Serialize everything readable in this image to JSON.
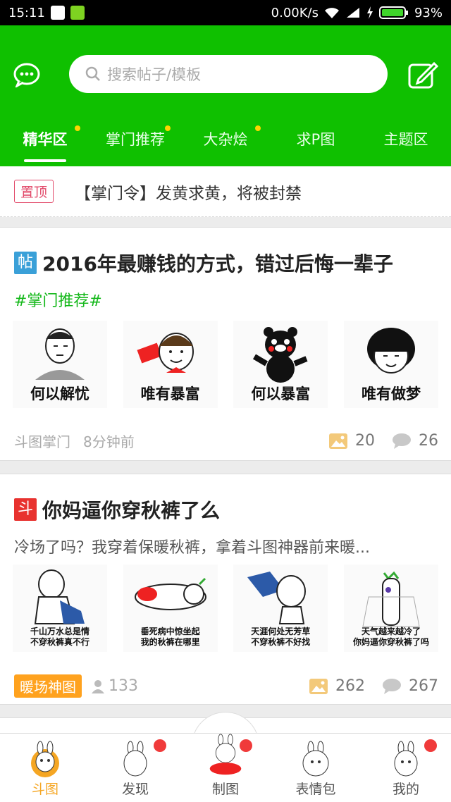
{
  "status_bar": {
    "time": "15:11",
    "network": "0.00K/s",
    "battery": "93%"
  },
  "header": {
    "search_placeholder": "搜索帖子/模板",
    "tabs": [
      {
        "label": "精华区",
        "dot": true,
        "active": true
      },
      {
        "label": "掌门推荐",
        "dot": true
      },
      {
        "label": "大杂烩",
        "dot": true
      },
      {
        "label": "求P图",
        "dot": false
      },
      {
        "label": "主题区",
        "dot": false
      }
    ]
  },
  "pinned": {
    "badge": "置顶",
    "text": "【掌门令】发黄求黄，将被封禁"
  },
  "posts": [
    {
      "tag_icon": "帖",
      "tag_color": "#3aa0d8",
      "title": "2016年最赚钱的方式，错过后悔一辈子",
      "subtitle": "#掌门推荐#",
      "images": [
        "何以解忧",
        "唯有暴富",
        "何以暴富",
        "唯有做梦"
      ],
      "author": "斗图掌门",
      "time": "8分钟前",
      "image_count": "20",
      "comment_count": "26"
    },
    {
      "tag_icon": "斗",
      "tag_color": "#e8322f",
      "title": "你妈逼你穿秋裤了么",
      "subtitle": "冷场了吗？我穿着保暖秋裤，拿着斗图神器前来暖...",
      "images": [
        "千山万水总是情\n不穿秋裤真不行",
        "垂死病中惊坐起\n我的秋裤在哪里",
        "天涯何处无芳草\n不穿秋裤不好找",
        "天气越来越冷了\n你妈逼你穿秋裤了吗"
      ],
      "badge": "暖场神图",
      "views": "133",
      "image_count": "262",
      "comment_count": "267"
    }
  ],
  "bottom_nav": [
    {
      "label": "斗图",
      "active": true
    },
    {
      "label": "发现",
      "dot": true
    },
    {
      "label": "制图",
      "dot": true
    },
    {
      "label": "表情包"
    },
    {
      "label": "我的",
      "dot": true
    }
  ],
  "colors": {
    "primary": "#0fc000",
    "accent_yellow": "#f5a623",
    "pin_red": "#e24a6a",
    "badge_orange": "#ffa21e"
  }
}
